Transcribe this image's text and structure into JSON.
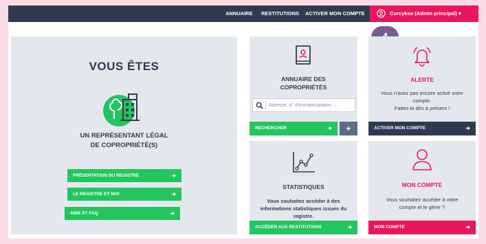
{
  "nav": {
    "links": [
      "ANNUAIRE",
      "RESTITUTIONS",
      "ACTIVER MON COMPTE"
    ],
    "user_label": "Curcykso (Admin principal)",
    "user_caret": "▾"
  },
  "badge": "4",
  "left": {
    "title": "VOUS ÊTES",
    "subtitle_line1": "UN REPRÉSENTANT LÉGAL",
    "subtitle_line2": "DE COPROPRIÉTÉ(S)",
    "buttons": [
      "PRÉSENTATION DU REGISTRE",
      "LE REGISTRE ET MOI",
      "AIDE ET FAQ"
    ]
  },
  "annuaire": {
    "title_line1": "ANNUAIRE DES",
    "title_line2": "COPROPRIÉTÉS",
    "search_placeholder": "Adresse, n° d'immatriculation, ...",
    "search_button": "RECHERCHER",
    "plus": "+"
  },
  "stats": {
    "title": "STATISTIQUES",
    "text_line1": "Vous souhaitez accéder à des",
    "text_line2": "informations statistiques issues du",
    "text_line3": "registre.",
    "button": "ACCÉDER AUX RESTITUTIONS"
  },
  "alerte": {
    "title": "ALERTE",
    "text_line1": "Vous n'avez pas encore activé votre",
    "text_line2": "compte.",
    "text_line3": "Faites-le dès à présent !",
    "button": "ACTIVER MON COMPTE"
  },
  "compte": {
    "title": "MON COMPTE",
    "text_line1": "Vous souhaitez accéder à votre",
    "text_line2": "compte et le gérer ?",
    "button": "MON COMPTE"
  },
  "arrow": "➔",
  "colors": {
    "navy": "#2f3a51",
    "pink": "#e8165b",
    "green": "#22c55e",
    "panel": "#e4e8ee",
    "badge": "#7b5b8f"
  }
}
